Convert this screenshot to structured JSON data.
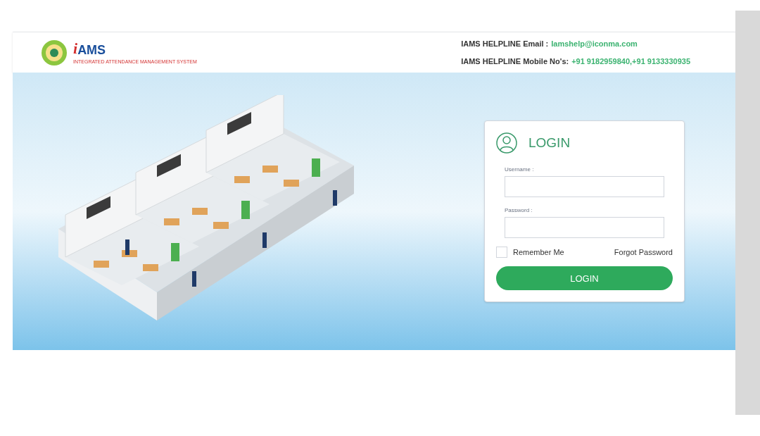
{
  "header": {
    "logo": {
      "mark": "i",
      "name": "AMS",
      "tagline": "INTEGRATED ATTENDANCE MANAGEMENT SYSTEM"
    },
    "helpline": [
      {
        "label": "IAMS HELPLINE Email :",
        "value": "Iamshelp@iconma.com"
      },
      {
        "label": "IAMS HELPLINE Mobile No's:",
        "value": "+91 9182959840,+91 9133330935"
      }
    ]
  },
  "login": {
    "title": "LOGIN",
    "fields": [
      {
        "label": "Username :"
      },
      {
        "label": "Password :"
      }
    ],
    "remember": {
      "label": "Remember Me",
      "checked": false
    },
    "forgot": "Forgot Password",
    "button": "LOGIN"
  }
}
